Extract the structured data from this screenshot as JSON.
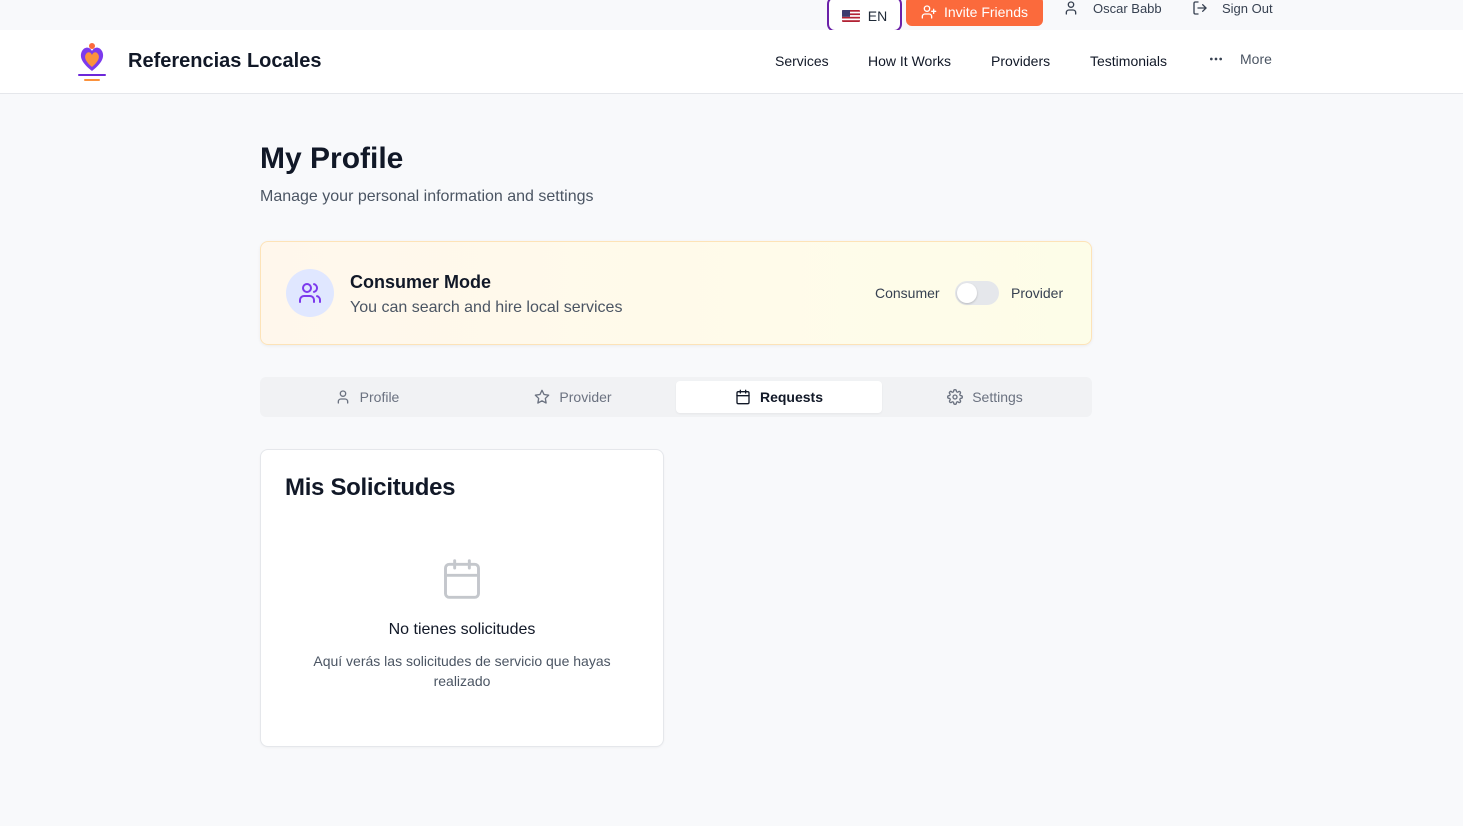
{
  "topbar": {
    "language": "EN",
    "invite_label": "Invite Friends",
    "user_name": "Oscar Babb",
    "signout_label": "Sign Out"
  },
  "header": {
    "brand": "Referencias Locales",
    "nav": [
      "Services",
      "How It Works",
      "Providers",
      "Testimonials"
    ],
    "more_label": "More"
  },
  "page": {
    "title": "My Profile",
    "subtitle": "Manage your personal information and settings"
  },
  "mode": {
    "title": "Consumer Mode",
    "description": "You can search and hire local services",
    "left_label": "Consumer",
    "right_label": "Provider",
    "provider_enabled": false
  },
  "tabs": [
    {
      "label": "Profile",
      "icon": "user-icon",
      "active": false
    },
    {
      "label": "Provider",
      "icon": "star-icon",
      "active": false
    },
    {
      "label": "Requests",
      "icon": "calendar-icon",
      "active": true
    },
    {
      "label": "Settings",
      "icon": "gear-icon",
      "active": false
    }
  ],
  "requests": {
    "title": "Mis Solicitudes",
    "empty_title": "No tienes solicitudes",
    "empty_description": "Aquí verás las solicitudes de servicio que hayas realizado"
  },
  "colors": {
    "accent": "#fb6a3c",
    "lang_border": "#6b21a8",
    "mode_icon": "#7c3aed"
  }
}
